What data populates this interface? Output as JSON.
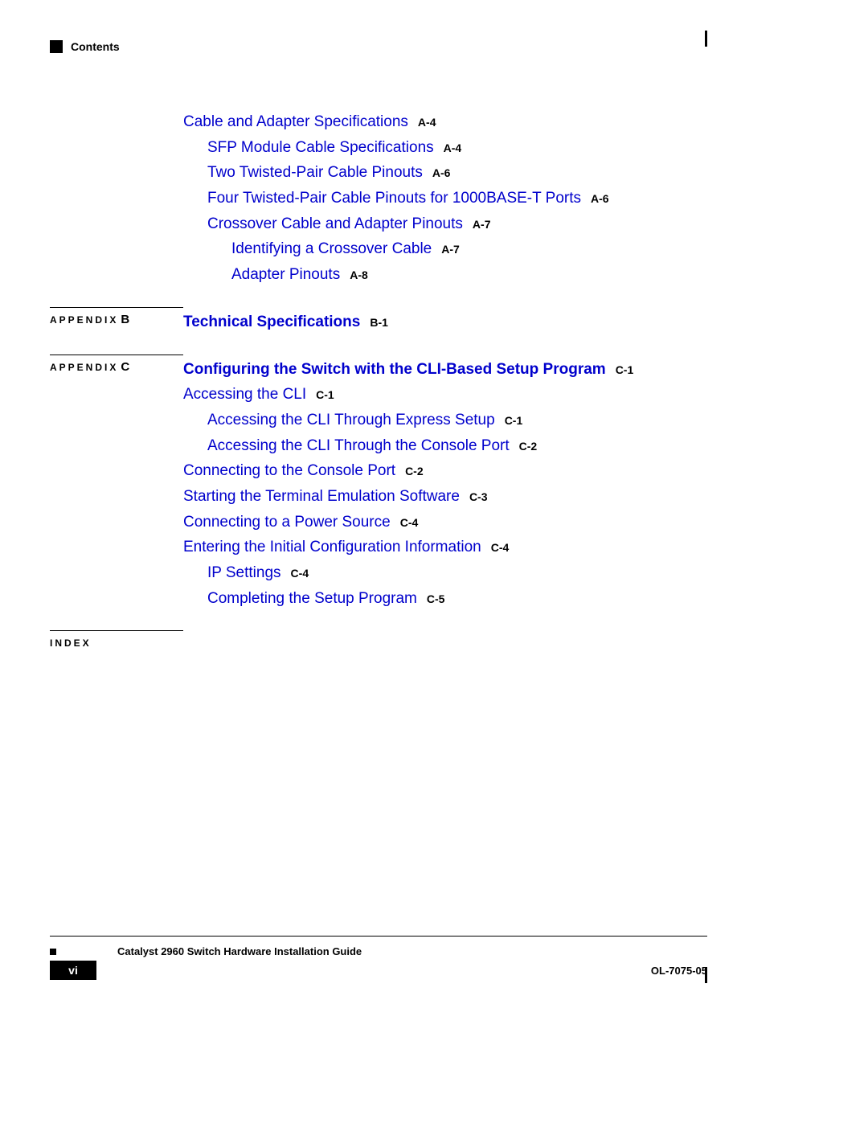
{
  "header": "Contents",
  "footer": {
    "title": "Catalyst 2960 Switch Hardware Installation Guide",
    "page": "vi",
    "doc": "OL-7075-05"
  },
  "sections": [
    {
      "label": "",
      "bigLabel": "",
      "showRule": false,
      "entries": [
        {
          "text": "Cable and Adapter Specifications",
          "ref": "A-4",
          "bold": false,
          "indent": 0
        },
        {
          "text": "SFP Module Cable Specifications",
          "ref": "A-4",
          "bold": false,
          "indent": 1
        },
        {
          "text": "Two Twisted-Pair Cable Pinouts",
          "ref": "A-6",
          "bold": false,
          "indent": 1
        },
        {
          "text": "Four Twisted-Pair Cable Pinouts for 1000BASE-T Ports",
          "ref": "A-6",
          "bold": false,
          "indent": 1
        },
        {
          "text": "Crossover Cable and Adapter Pinouts",
          "ref": "A-7",
          "bold": false,
          "indent": 1
        },
        {
          "text": "Identifying a Crossover Cable",
          "ref": "A-7",
          "bold": false,
          "indent": 2
        },
        {
          "text": "Adapter Pinouts",
          "ref": "A-8",
          "bold": false,
          "indent": 2
        }
      ]
    },
    {
      "label": "APPENDIX",
      "bigLabel": "B",
      "showRule": true,
      "entries": [
        {
          "text": "Technical Specifications",
          "ref": "B-1",
          "bold": true,
          "indent": 0
        }
      ]
    },
    {
      "label": "APPENDIX",
      "bigLabel": "C",
      "showRule": true,
      "entries": [
        {
          "text": "Configuring the Switch with the CLI-Based Setup Program",
          "ref": "C-1",
          "bold": true,
          "indent": 0
        },
        {
          "text": "Accessing the CLI",
          "ref": "C-1",
          "bold": false,
          "indent": 0
        },
        {
          "text": "Accessing the CLI Through Express Setup",
          "ref": "C-1",
          "bold": false,
          "indent": 1
        },
        {
          "text": "Accessing the CLI Through the Console Port",
          "ref": "C-2",
          "bold": false,
          "indent": 1
        },
        {
          "text": "Connecting to the Console Port",
          "ref": "C-2",
          "bold": false,
          "indent": 0
        },
        {
          "text": "Starting the Terminal Emulation Software",
          "ref": "C-3",
          "bold": false,
          "indent": 0
        },
        {
          "text": "Connecting to a Power Source",
          "ref": "C-4",
          "bold": false,
          "indent": 0
        },
        {
          "text": "Entering the Initial Configuration Information",
          "ref": "C-4",
          "bold": false,
          "indent": 0
        },
        {
          "text": "IP Settings",
          "ref": "C-4",
          "bold": false,
          "indent": 1
        },
        {
          "text": "Completing the Setup Program",
          "ref": "C-5",
          "bold": false,
          "indent": 1
        }
      ]
    },
    {
      "label": "INDEX",
      "bigLabel": "",
      "showRule": true,
      "entries": []
    }
  ]
}
